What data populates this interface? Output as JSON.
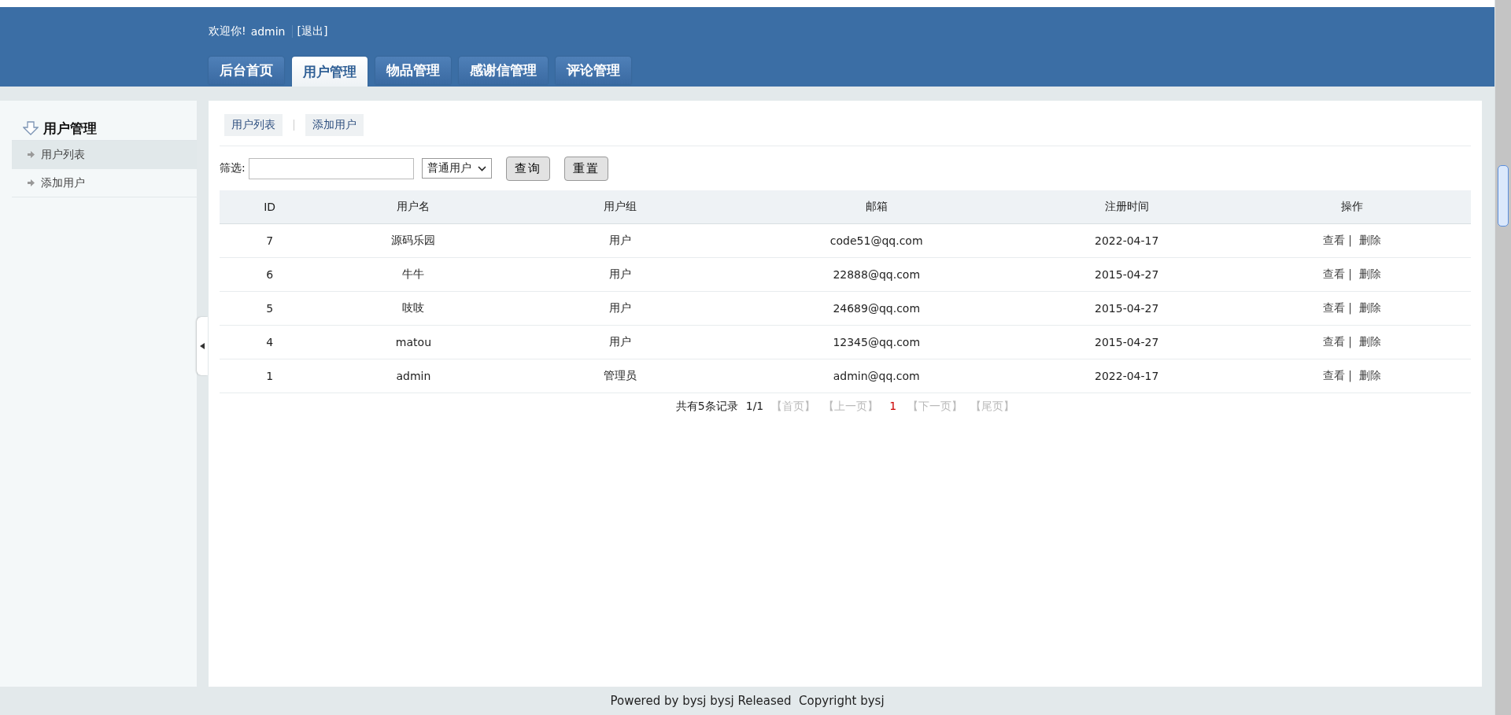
{
  "header": {
    "greeting": "欢迎你!",
    "username": "admin",
    "logout": "[退出]"
  },
  "tabs": [
    {
      "label": "后台首页",
      "selected": false
    },
    {
      "label": "用户管理",
      "selected": true
    },
    {
      "label": "物品管理",
      "selected": false
    },
    {
      "label": "感谢信管理",
      "selected": false
    },
    {
      "label": "评论管理",
      "selected": false
    }
  ],
  "sidebar": {
    "title": "用户管理",
    "items": [
      {
        "label": "用户列表",
        "selected": true
      },
      {
        "label": "添加用户",
        "selected": false
      }
    ]
  },
  "subnav": [
    "用户列表",
    "添加用户"
  ],
  "filter": {
    "label": "筛选:",
    "select": "普通用户",
    "buttons": [
      "查询",
      "重置"
    ]
  },
  "table": {
    "columns": [
      "ID",
      "用户名",
      "用户组",
      "邮箱",
      "注册时间",
      "操作"
    ],
    "rows": [
      {
        "cells": [
          "7",
          "源码乐园",
          "用户",
          "code51@qq.com",
          "2022-04-17"
        ],
        "actions": [
          "查看",
          "删除"
        ],
        "separator": "|"
      },
      {
        "cells": [
          "6",
          "牛牛",
          "用户",
          "22888@qq.com",
          "2015-04-27"
        ],
        "actions": [
          "查看",
          "删除"
        ],
        "separator": "|"
      },
      {
        "cells": [
          "5",
          "吱吱",
          "用户",
          "24689@qq.com",
          "2015-04-27"
        ],
        "actions": [
          "查看",
          "删除"
        ],
        "separator": "|"
      },
      {
        "cells": [
          "4",
          "matou",
          "用户",
          "12345@qq.com",
          "2015-04-27"
        ],
        "actions": [
          "查看",
          "删除"
        ],
        "separator": "|"
      },
      {
        "cells": [
          "1",
          "admin",
          "管理员",
          "admin@qq.com",
          "2022-04-17"
        ],
        "actions": [
          "查看",
          "删除"
        ],
        "separator": "|"
      }
    ]
  },
  "pagination": [
    {
      "kind": "text",
      "label": "共有5条记录"
    },
    {
      "kind": "text",
      "label": "1/1"
    },
    {
      "kind": "link",
      "label": "【首页】",
      "disabled": true
    },
    {
      "kind": "link",
      "label": "【上一页】",
      "disabled": true
    },
    {
      "kind": "current",
      "label": "1"
    },
    {
      "kind": "link",
      "label": "【下一页】",
      "disabled": true
    },
    {
      "kind": "link",
      "label": "【尾页】",
      "disabled": true
    }
  ],
  "footer": "Powered by bysj bysj Released  Copyright bysj"
}
